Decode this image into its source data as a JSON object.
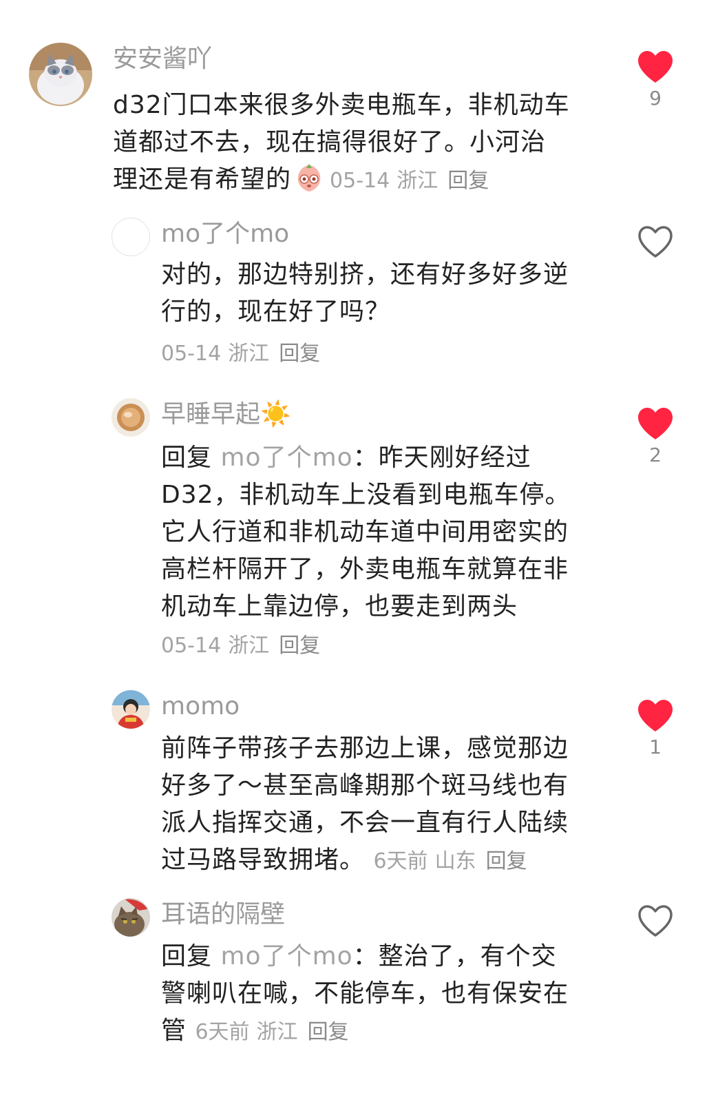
{
  "colors": {
    "like_active": "#ff2442",
    "like_inactive": "#666666",
    "meta": "#a3a3a3",
    "username": "#9a9a9a"
  },
  "comments": [
    {
      "username": "安安酱吖",
      "avatar": "cat-avatar",
      "lines": [
        "d32门口本来很多外卖电瓶车，非机动车",
        "道都过不去，现在搞得很好了。小河治",
        "理还是有希望的"
      ],
      "emoji": "peach-face-emoji",
      "date": "05-14",
      "region": "浙江",
      "reply_label": "回复",
      "liked": true,
      "like_count": "9"
    },
    {
      "username": "mo了个mo",
      "avatar": "blank-avatar",
      "lines": [
        "对的，那边特别挤，还有好多好多逆",
        "行的，现在好了吗？"
      ],
      "date": "05-14",
      "region": "浙江",
      "reply_label": "回复",
      "liked": false,
      "like_count": ""
    },
    {
      "username": "早睡早起☀️",
      "avatar": "coffee-avatar",
      "reply_prefix": "回复",
      "reply_target": "mo了个mo",
      "first_line_rest": "：昨天刚好经过",
      "lines": [
        "D32，非机动车上没看到电瓶车停。",
        "它人行道和非机动车道中间用密实的",
        "高栏杆隔开了，外卖电瓶车就算在非",
        "机动车上靠边停，也要走到两头"
      ],
      "date": "05-14",
      "region": "浙江",
      "reply_label": "回复",
      "liked": true,
      "like_count": "2"
    },
    {
      "username": "momo",
      "avatar": "girl-avatar",
      "lines": [
        "前阵子带孩子去那边上课，感觉那边",
        "好多了～甚至高峰期那个斑马线也有",
        "派人指挥交通，不会一直有行人陆续",
        "过马路导致拥堵。"
      ],
      "date": "6天前",
      "region": "山东",
      "reply_label": "回复",
      "liked": true,
      "like_count": "1"
    },
    {
      "username": "耳语的隔壁",
      "avatar": "tabby-cat-avatar",
      "reply_prefix": "回复",
      "reply_target": "mo了个mo",
      "first_line_rest": "：整治了，有个交",
      "lines": [
        "警喇叭在喊，不能停车，也有保安在",
        "管"
      ],
      "date": "6天前",
      "region": "浙江",
      "reply_label": "回复",
      "liked": false,
      "like_count": ""
    }
  ]
}
